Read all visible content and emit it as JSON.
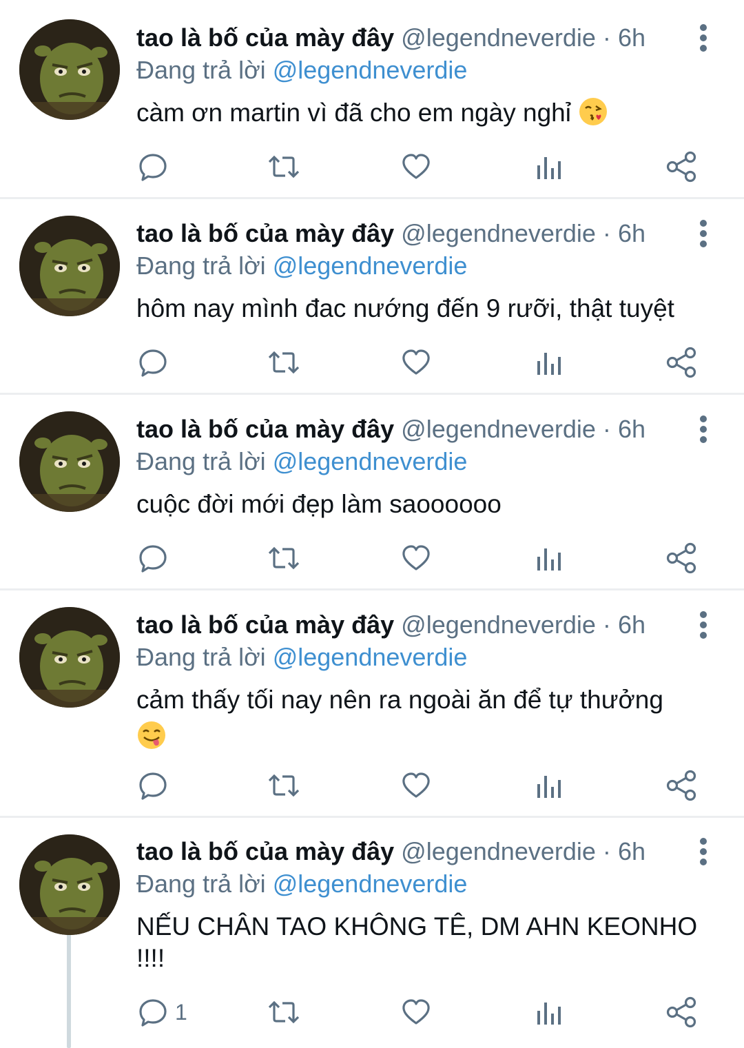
{
  "tweets": [
    {
      "name": "tao là bố của mày đây",
      "handle": "@legendneverdie",
      "dot": "·",
      "time": "6h",
      "reply_prefix": "Đang trả lời",
      "reply_to": "@legendneverdie",
      "text": "càm ơn martin vì đã cho em ngày nghỉ",
      "emoji": "face-blowing-kiss-emoji",
      "reply_count": ""
    },
    {
      "name": "tao là bố của mày đây",
      "handle": "@legendneverdie",
      "dot": "·",
      "time": "6h",
      "reply_prefix": "Đang trả lời",
      "reply_to": "@legendneverdie",
      "text": "hôm nay mình đac nướng đến 9 rưỡi, thật tuyệt",
      "emoji": "",
      "reply_count": ""
    },
    {
      "name": "tao là bố của mày đây",
      "handle": "@legendneverdie",
      "dot": "·",
      "time": "6h",
      "reply_prefix": "Đang trả lời",
      "reply_to": "@legendneverdie",
      "text": "cuộc đời mới đẹp làm saoooooo",
      "emoji": "",
      "reply_count": ""
    },
    {
      "name": "tao là bố của mày đây",
      "handle": "@legendneverdie",
      "dot": "·",
      "time": "6h",
      "reply_prefix": "Đang trả lời",
      "reply_to": "@legendneverdie",
      "text": "cảm thấy tối nay nên ra ngoài ăn để tự thưởng",
      "emoji": "face-savoring-food-emoji",
      "reply_count": ""
    },
    {
      "name": "tao là bố của mày đây",
      "handle": "@legendneverdie",
      "dot": "·",
      "time": "6h",
      "reply_prefix": "Đang trả lời",
      "reply_to": "@legendneverdie",
      "text": "NẾU CHÂN TAO KHÔNG TÊ, DM AHN KEONHO !!!!",
      "emoji": "",
      "reply_count": "1"
    }
  ],
  "icons": {
    "reply": "reply-icon",
    "retweet": "retweet-icon",
    "like": "like-icon",
    "analytics": "analytics-icon",
    "share": "share-icon",
    "more": "more-vertical-icon",
    "avatar": "profile-avatar"
  },
  "colors": {
    "link": "#3e8fd0",
    "secondary_text": "#5b7083",
    "divider": "#eceef0",
    "thread_line": "#cfd9de"
  }
}
